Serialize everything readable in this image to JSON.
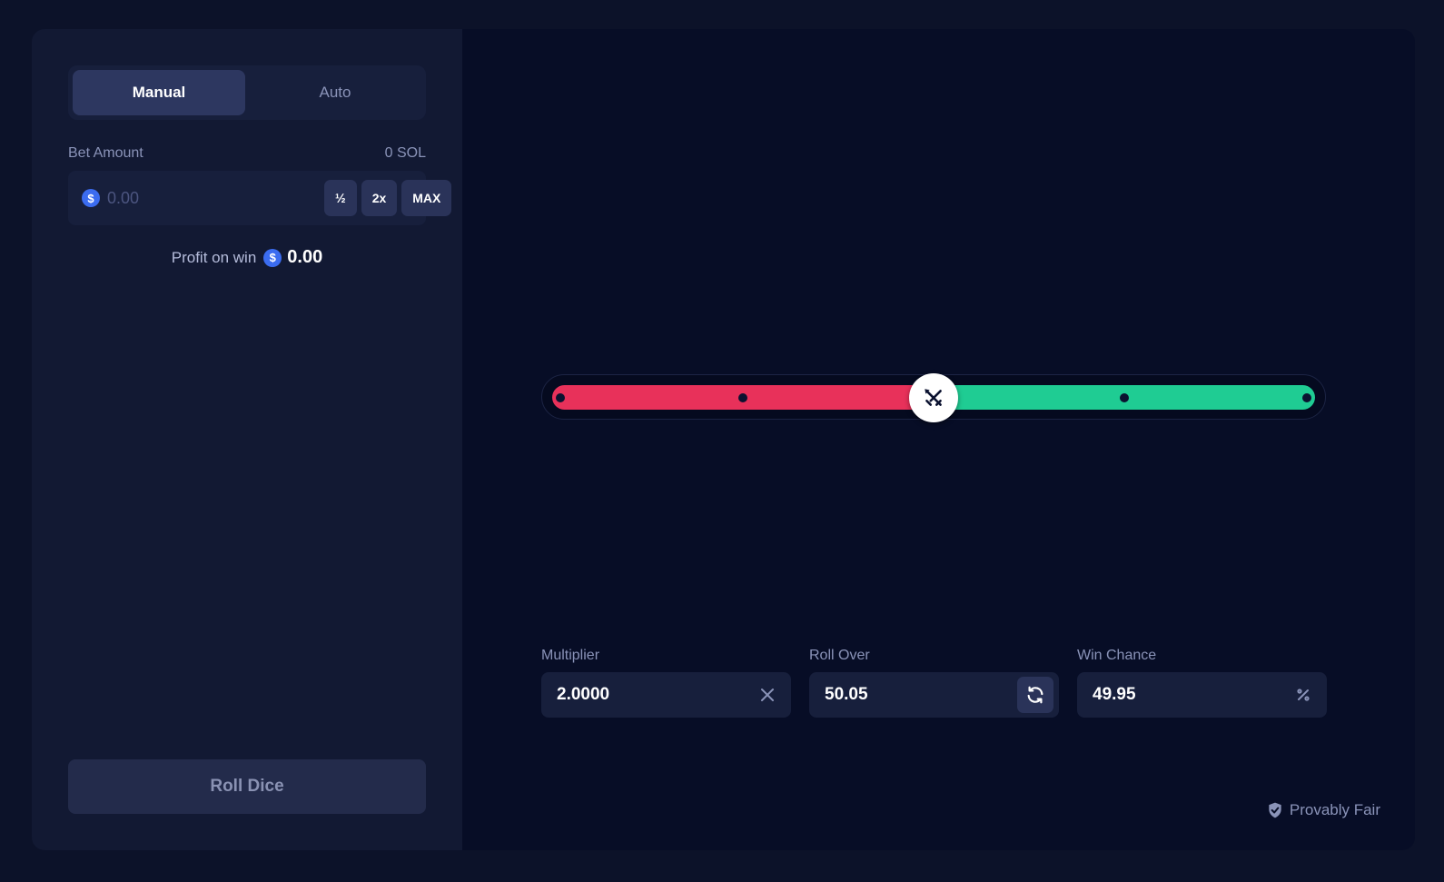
{
  "tabs": [
    {
      "label": "Manual",
      "active": true
    },
    {
      "label": "Auto",
      "active": false
    }
  ],
  "bet": {
    "label": "Bet Amount",
    "balance": "0 SOL",
    "placeholder": "0.00",
    "currency_icon": "dollar-coin-icon",
    "half_label": "½",
    "double_label": "2x",
    "max_label": "MAX"
  },
  "profit": {
    "label": "Profit on win",
    "value": "0.00"
  },
  "roll_button": {
    "label": "Roll Dice"
  },
  "slider": {
    "value": 50.05,
    "min": 0,
    "max": 100,
    "markers": [
      0,
      25,
      50,
      75,
      100
    ],
    "lose_color": "#e8315a",
    "win_color": "#1fcc93",
    "handle_icon": "crossed-swords-icon"
  },
  "fields": {
    "multiplier": {
      "label": "Multiplier",
      "value": "2.0000",
      "icon": "close-icon"
    },
    "roll_over": {
      "label": "Roll Over",
      "value": "50.05",
      "icon": "refresh-icon"
    },
    "win_chance": {
      "label": "Win Chance",
      "value": "49.95",
      "icon": "percent-icon"
    }
  },
  "provably_fair": {
    "label": "Provably Fair",
    "icon": "shield-check-icon"
  }
}
